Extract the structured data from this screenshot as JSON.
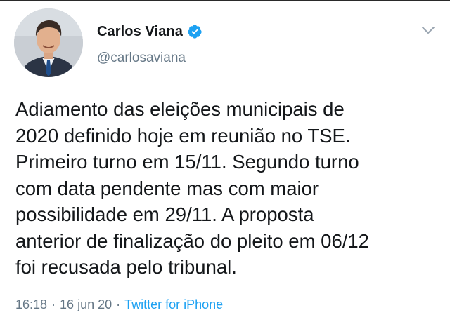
{
  "author": {
    "display_name": "Carlos Viana",
    "handle": "@carlosaviana",
    "verified": true
  },
  "icons": {
    "verified": "verified-badge-icon",
    "more": "chevron-down-icon",
    "avatar": "profile-photo"
  },
  "tweet": {
    "text": "Adiamento das eleições municipais de\n2020 definido hoje em reunião no TSE.\nPrimeiro turno em 15/11. Segundo turno\ncom data pendente mas com maior\npossibilidade em 29/11. A proposta\nanterior de finalização do pleito em 06/12\nfoi recusada pelo tribunal."
  },
  "meta": {
    "time": "16:18",
    "separator": "·",
    "date": "16 jun 20",
    "source": "Twitter for iPhone"
  },
  "colors": {
    "accent": "#1da1f2",
    "secondary_text": "#657786",
    "primary_text": "#14171a"
  }
}
